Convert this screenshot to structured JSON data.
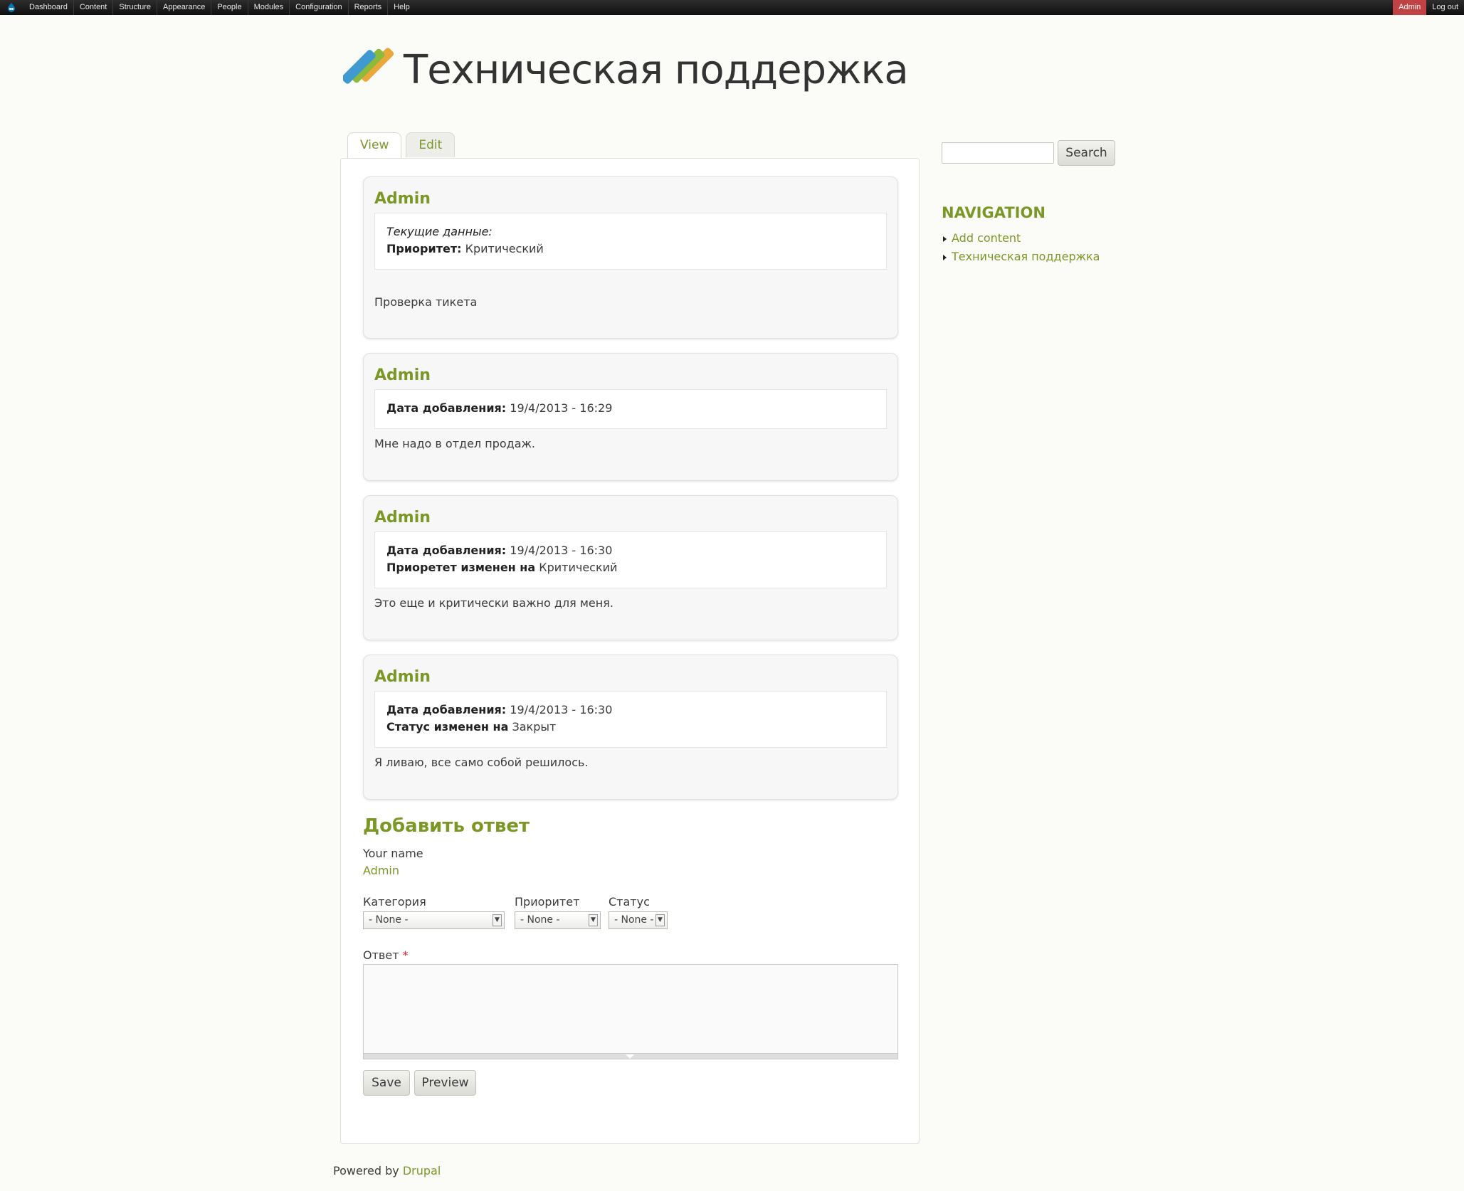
{
  "toolbar": {
    "menu": [
      "Dashboard",
      "Content",
      "Structure",
      "Appearance",
      "People",
      "Modules",
      "Configuration",
      "Reports",
      "Help"
    ],
    "user_name": "Admin",
    "logout": "Log out",
    "accent": "#c04244"
  },
  "site": {
    "name": "Техническая поддержка"
  },
  "tabs": {
    "view": "View",
    "edit": "Edit"
  },
  "comments": [
    {
      "author": "Admin",
      "meta_heading": "Текущие данные:",
      "meta_label": "Приоритет:",
      "meta_value": "Критический",
      "body": "Проверка тикета"
    },
    {
      "author": "Admin",
      "date_label": "Дата добавления:",
      "date_value": "19/4/2013 - 16:29",
      "body": "Мне надо в отдел продаж."
    },
    {
      "author": "Admin",
      "date_label": "Дата добавления:",
      "date_value": "19/4/2013 - 16:30",
      "change_label": "Приоретет изменен на",
      "change_value": "Критический",
      "body": "Это еще и критически важно для меня."
    },
    {
      "author": "Admin",
      "date_label": "Дата добавления:",
      "date_value": "19/4/2013 - 16:30",
      "change_label": "Статус изменен на",
      "change_value": "Закрыт",
      "body": "Я ливаю, все само собой решилось."
    }
  ],
  "reply": {
    "title": "Добавить ответ",
    "name_label": "Your name",
    "name_value": "Admin",
    "category_label": "Категория",
    "category_value": "- None -",
    "priority_label": "Приоритет",
    "priority_value": "- None -",
    "status_label": "Статус",
    "status_value": "- None -",
    "answer_label": "Ответ",
    "required_mark": "*",
    "save": "Save",
    "preview": "Preview"
  },
  "sidebar": {
    "search_button": "Search",
    "nav_title": "NAVIGATION",
    "nav_items": [
      "Add content",
      "Техническая поддержка"
    ]
  },
  "footer": {
    "prefix": "Powered by",
    "link": "Drupal"
  },
  "colors": {
    "brand_green": "#7b9827",
    "background": "#fbfbf7"
  }
}
